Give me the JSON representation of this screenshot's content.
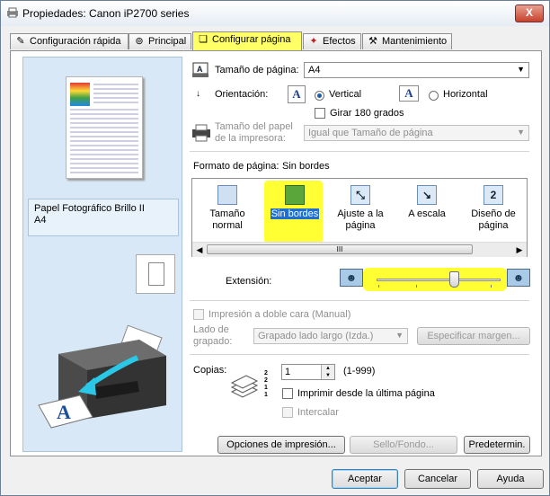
{
  "window": {
    "title": "Propiedades: Canon iP2700 series",
    "close_glyph": "X",
    "highlight_color": "#ffff33"
  },
  "tabs": [
    {
      "label": "Configuración rápida",
      "icon": "quick-setup-icon",
      "active": false
    },
    {
      "label": "Principal",
      "icon": "main-icon",
      "active": false
    },
    {
      "label": "Configurar página",
      "icon": "page-setup-icon",
      "active": true
    },
    {
      "label": "Efectos",
      "icon": "effects-icon",
      "active": false
    },
    {
      "label": "Mantenimiento",
      "icon": "maintenance-icon",
      "active": false
    }
  ],
  "preview": {
    "media_line1": "Papel Fotográfico Brillo II",
    "media_line2": "A4"
  },
  "page_size": {
    "label": "Tamaño de página:",
    "value": "A4"
  },
  "orientation": {
    "label": "Orientación:",
    "vertical": "Vertical",
    "horizontal": "Horizontal",
    "selected": "vertical",
    "rotate_label": "Girar 180 grados",
    "icon_glyph": "A"
  },
  "printer_paper": {
    "label_line1": "Tamaño del papel",
    "label_line2": "de la impresora:",
    "value": "Igual que Tamaño de página"
  },
  "page_layout": {
    "label": "Formato de página:",
    "value": "Sin bordes",
    "items": [
      {
        "line1": "Tamaño",
        "line2": "normal"
      },
      {
        "line1": "Sin bordes",
        "line2": ""
      },
      {
        "line1": "Ajuste a la",
        "line2": "página"
      },
      {
        "line1": "A escala",
        "line2": ""
      },
      {
        "line1": "Diseño de",
        "line2": "página",
        "icon_text": "2"
      }
    ],
    "scroll_glyph": "III"
  },
  "extension": {
    "label": "Extensión:",
    "level": 0.62,
    "person_glyph": "☻"
  },
  "duplex": {
    "label": "Impresión a doble cara (Manual)",
    "binding_label_line1": "Lado de",
    "binding_label_line2": "grapado:",
    "binding_value": "Grapado lado largo (Izda.)",
    "margin_button": "Especificar margen..."
  },
  "copies": {
    "label": "Copias:",
    "value": "1",
    "range": "(1-999)",
    "last_page_label": "Imprimir desde la última página",
    "collate_label": "Intercalar",
    "collate_numbers": "2\n2\n1\n1"
  },
  "buttons": {
    "print_options": "Opciones de impresión...",
    "stamp": "Sello/Fondo...",
    "defaults": "Predetermin.",
    "ok": "Aceptar",
    "cancel": "Cancelar",
    "help": "Ayuda"
  }
}
